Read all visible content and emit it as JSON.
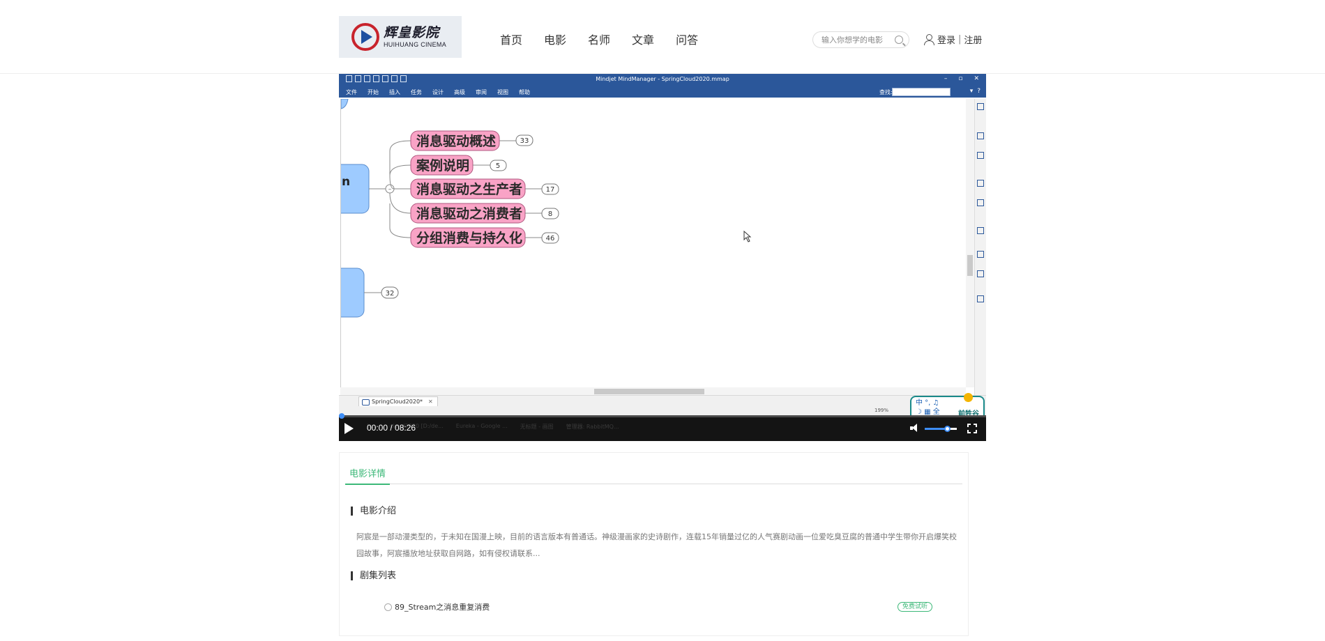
{
  "header": {
    "logo_cn": "辉皇影院",
    "logo_en": "HUIHUANG CINEMA",
    "nav": [
      "首页",
      "电影",
      "名师",
      "文章",
      "问答"
    ],
    "search_placeholder": "输入你想学的电影",
    "login": "登录",
    "separator": "|",
    "register": "注册"
  },
  "player": {
    "app_title": "Mindjet MindManager - SpringCloud2020.mmap",
    "window_controls": [
      "–",
      "▫",
      "✕"
    ],
    "ribbon_tabs": [
      "文件",
      "开始",
      "插入",
      "任务",
      "设计",
      "高级",
      "审阅",
      "视图",
      "帮助"
    ],
    "find_label": "查找:",
    "mindmap": {
      "root_partial_label": "n",
      "topics": [
        {
          "label": "消息驱动概述",
          "count": "33"
        },
        {
          "label": "案例说明",
          "count": "5"
        },
        {
          "label": "消息驱动之生产者",
          "count": "17"
        },
        {
          "label": "消息驱动之消费者",
          "count": "8"
        },
        {
          "label": "分组消费与持久化",
          "count": "46"
        }
      ],
      "lower_count": "32",
      "collapse_symbol": "–"
    },
    "doc_tab": "SpringCloud2020*",
    "doc_tab_close": "✕",
    "zoom": "199%",
    "ime": {
      "line1": "中 °, ♫",
      "line2": "☽ ▦ 全",
      "brand": "前牲谷"
    },
    "taskbar_ghost": [
      "Ja...",
      "cloud2020 [D:/de...",
      "Eureka - Google ...",
      "无标题 - 画图",
      "管理器: RabbitMQ..."
    ],
    "time": "00:00 / 08:26",
    "progress": 0.0,
    "volume": 0.7,
    "accent": "#3e8ef7"
  },
  "details": {
    "tab": "电影详情",
    "intro_title": "电影介绍",
    "intro_text": "阿宸是一部动漫类型的，于未知在国漫上映，目前的语言版本有普通话。神级漫画家的史诗剧作，连载15年销量过亿的人气赛剧动画一位爱吃臭豆腐的普通中学生带你开启爆笑校园故事，阿宸播放地址获取自网路，如有侵权请联系...",
    "episodes_title": "剧集列表",
    "episodes": [
      {
        "title": "89_Stream之消息重复消费",
        "badge": "免费试听"
      }
    ],
    "accent": "#3cb878"
  }
}
